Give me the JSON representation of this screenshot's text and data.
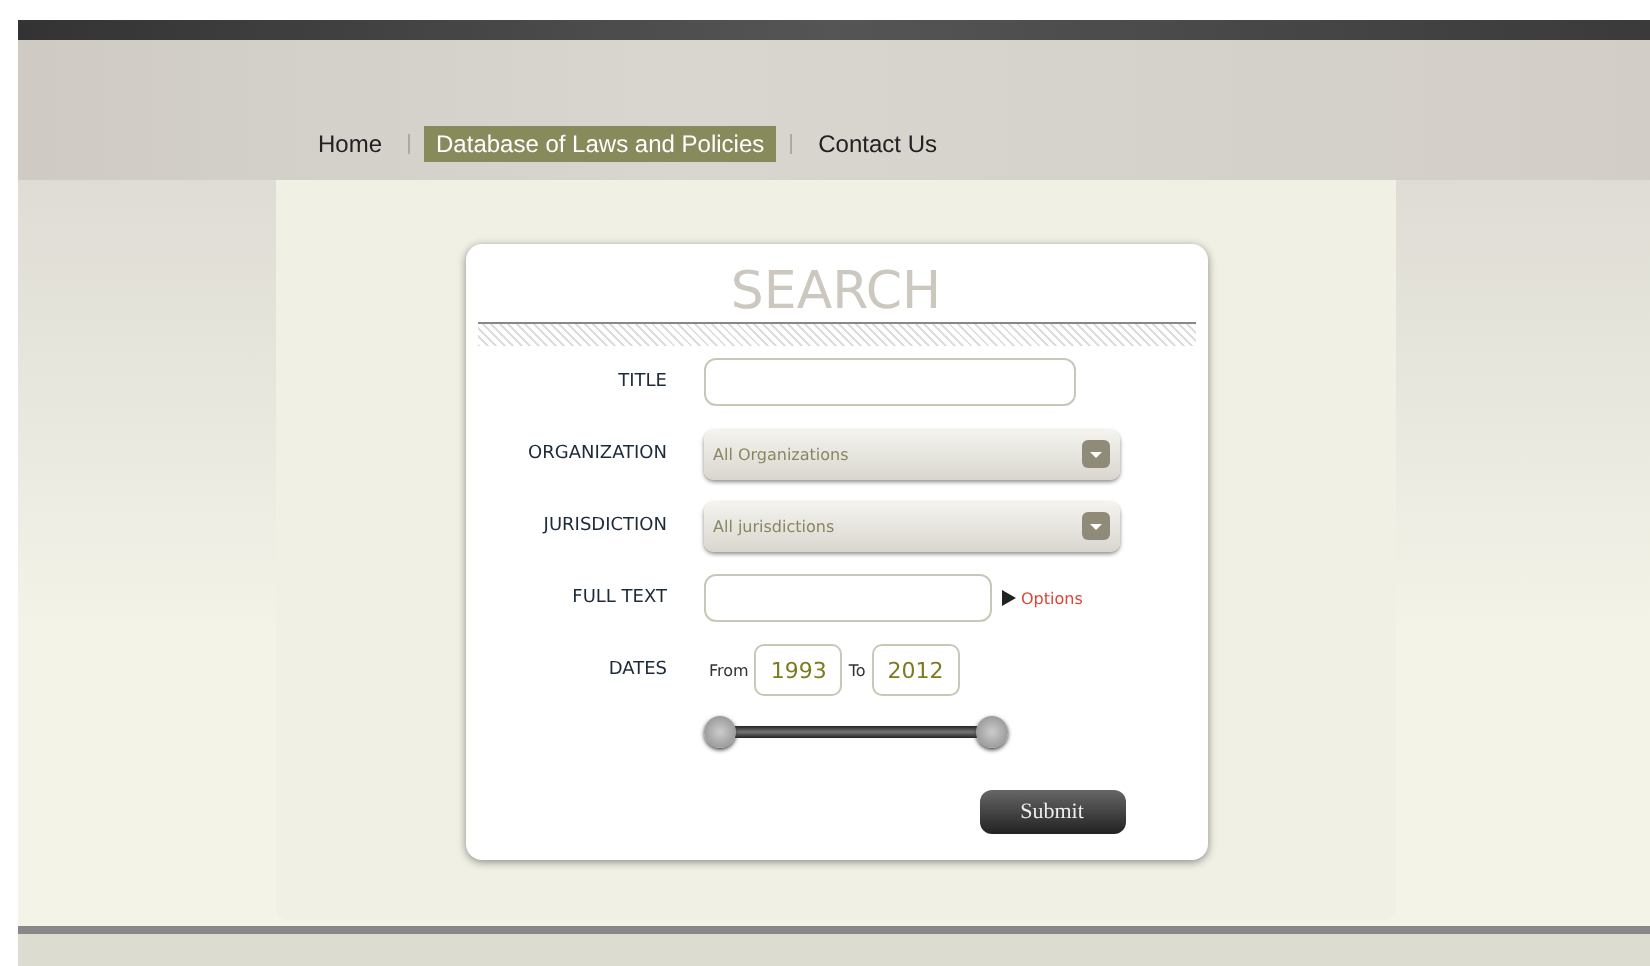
{
  "nav": [
    {
      "label": "Home",
      "selected": false
    },
    {
      "label": "Database of Laws and Policies",
      "selected": true
    },
    {
      "label": "Contact Us",
      "selected": false
    }
  ],
  "search": {
    "heading": "SEARCH",
    "fields": [
      {
        "kind": "text",
        "label": "TITLE"
      },
      {
        "kind": "select",
        "label": "ORGANIZATION",
        "value": "All Organizations"
      },
      {
        "kind": "select",
        "label": "JURISDICTION",
        "value": "All jurisdictions"
      },
      {
        "kind": "fulltext",
        "label": "FULL TEXT",
        "link": "Options"
      },
      {
        "kind": "dates",
        "label": "DATES",
        "from_label": "From",
        "from": "1993",
        "to_label": "To",
        "to": "2012"
      }
    ],
    "slider": {
      "thumbs": [
        {
          "level": 0
        },
        {
          "level": 1
        }
      ]
    },
    "submit": "Submit"
  }
}
